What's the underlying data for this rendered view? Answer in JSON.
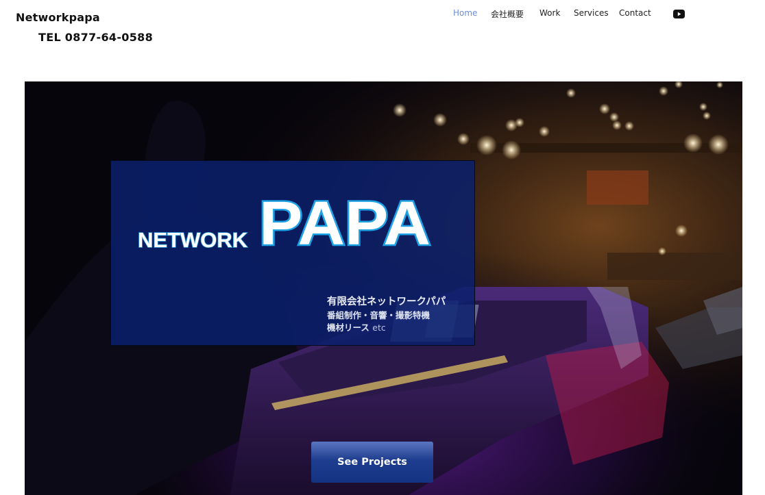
{
  "header": {
    "site_name": "Networkpapa",
    "phone": "TEL 0877-64-0588"
  },
  "nav": {
    "items": [
      {
        "label": "Home",
        "active": true
      },
      {
        "label": "会社概要",
        "active": false
      },
      {
        "label": "Work",
        "active": false
      },
      {
        "label": "Services",
        "active": false
      },
      {
        "label": "Contact",
        "active": false
      }
    ],
    "social_icon": "youtube-icon"
  },
  "hero": {
    "logo": {
      "word1": "NETWORK",
      "word2": "PAPA"
    },
    "company_name": "有限会社ネットワークパパ",
    "line2": "番組制作・音響・撮影特機",
    "line3": "機材リース",
    "line3_suffix": "etc",
    "cta_label": "See Projects"
  },
  "colors": {
    "nav_active": "#6b8fd6",
    "card_bg": "#0a206c",
    "cta_bg": "#143381"
  }
}
